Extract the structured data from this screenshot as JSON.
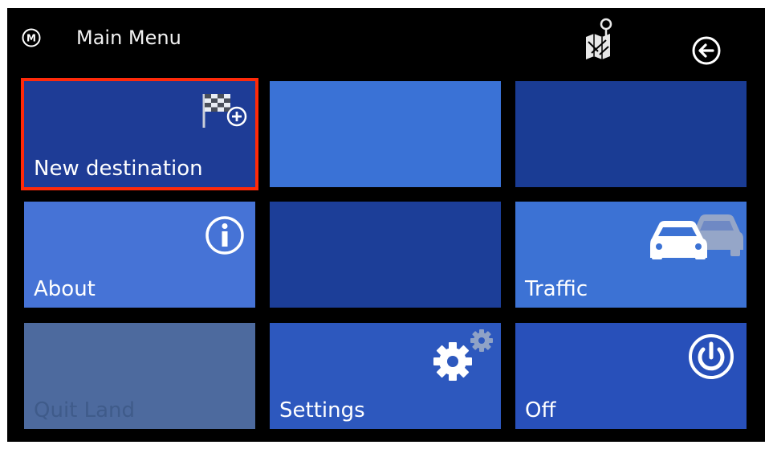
{
  "header": {
    "title": "Main Menu",
    "menu_badge_letter": "M",
    "icons": {
      "menu": "m-circle-icon",
      "map": "map-pin-icon",
      "back": "back-arrow-icon"
    }
  },
  "tiles": [
    {
      "label": "New destination",
      "icon": "checkered-flag-plus-icon",
      "color": "#1e3c96",
      "selected": true
    },
    {
      "label": "",
      "icon": "",
      "color": "#3a72d6"
    },
    {
      "label": "",
      "icon": "",
      "color": "#1a3c94"
    },
    {
      "label": "About",
      "icon": "info-icon",
      "color": "#4673d6"
    },
    {
      "label": "",
      "icon": "",
      "color": "#1c3e98"
    },
    {
      "label": "Traffic",
      "icon": "cars-icon",
      "color": "#3c72d4"
    },
    {
      "label": "Quit Land",
      "icon": "",
      "color": "#4d6a9e",
      "disabled": true
    },
    {
      "label": "Settings",
      "icon": "gears-icon",
      "color": "#2d58be"
    },
    {
      "label": "Off",
      "icon": "power-icon",
      "color": "#2850ba"
    }
  ],
  "colors": {
    "background": "#000000",
    "selection_border": "#ff2a0a",
    "text": "#ffffff"
  }
}
